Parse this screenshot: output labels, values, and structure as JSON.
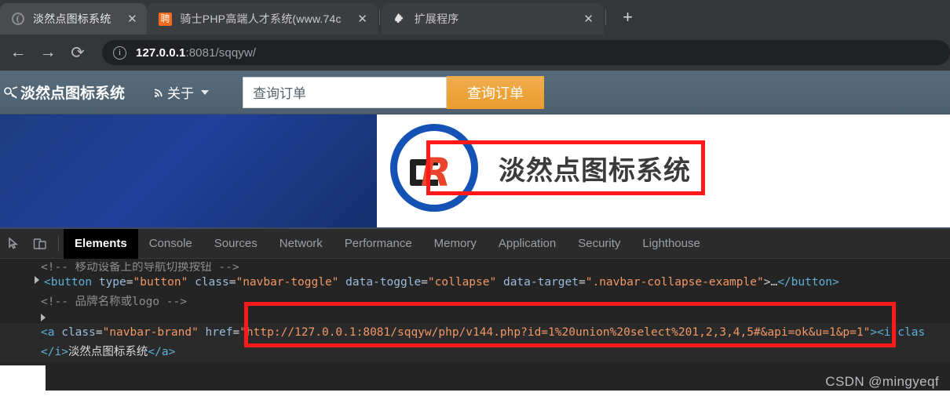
{
  "browser": {
    "tabs": [
      {
        "title": "淡然点图标系统",
        "favicon": "globe-icon",
        "active": true,
        "close_label": "✕"
      },
      {
        "title": "骑士PHP高端人才系统(www.74c",
        "favicon": "recruit-orange-icon",
        "favicon_char": "聘",
        "active": false,
        "close_label": "✕"
      },
      {
        "title": "扩展程序",
        "favicon": "puzzle-piece-icon",
        "active": false,
        "close_label": "✕"
      }
    ],
    "new_tab_label": "+",
    "toolbar": {
      "back_label": "←",
      "forward_label": "→",
      "reload_label": "⟳",
      "site_info_label": "i"
    },
    "omnibox": {
      "host": "127.0.0.1",
      "rest": ":8081/sqqyw/",
      "full_url": "127.0.0.1:8081/sqqyw/"
    }
  },
  "page": {
    "navbar": {
      "brand": "淡然点图标系统",
      "about_link": "关于",
      "search_placeholder": "查询订单",
      "search_button": "查询订单"
    },
    "hero": {
      "logo_letters": "DR",
      "logo_title": "淡然点图标系统"
    }
  },
  "devtools": {
    "tabs": [
      "Elements",
      "Console",
      "Sources",
      "Network",
      "Performance",
      "Memory",
      "Application",
      "Security",
      "Lighthouse"
    ],
    "active_tab": "Elements",
    "icons": {
      "inspect": "inspect-element-icon",
      "device": "device-toolbar-icon"
    },
    "code": {
      "line_clipped_comment": "<!-- 移动设备上的导航切换按钮 -->",
      "line_button": {
        "tag_open": "<button",
        "attr1_name": "type",
        "attr1_value": "\"button\"",
        "attr2_name": "class",
        "attr2_value": "\"navbar-toggle\"",
        "attr3_name": "data-toggle",
        "attr3_value": "\"collapse\"",
        "attr4_name": "data-target",
        "attr4_value": "\".navbar-collapse-example\"",
        "tag_mid": ">…",
        "tag_close": "</button>"
      },
      "line_comment": "<!-- 品牌名称或logo -->",
      "line_anchor": {
        "tag_open": "<a",
        "attr1_name": "class",
        "attr1_value": "\"navbar-brand\"",
        "attr2_name": "href",
        "attr2_value": "\"http://127.0.0.1:8081/sqqyw/php/v144.php?id=1%20union%20select%201,2,3,4,5#&api=ok&u=1&p=1\"",
        "tag_mid": ">",
        "trailing": "<i clas"
      },
      "line_anchor_close": {
        "close_i": "</i>",
        "text": "淡然点图标系统",
        "close_a": "</a>"
      }
    }
  },
  "watermark": "CSDN @mingyeqf",
  "colors": {
    "accent_orange": "#efa83f",
    "navbar_slate": "#55697a",
    "hero_blue": "#20409a",
    "annotation_red": "#ff1a1a",
    "logo_red": "#e8452c",
    "logo_ring_blue": "#1453b5"
  }
}
